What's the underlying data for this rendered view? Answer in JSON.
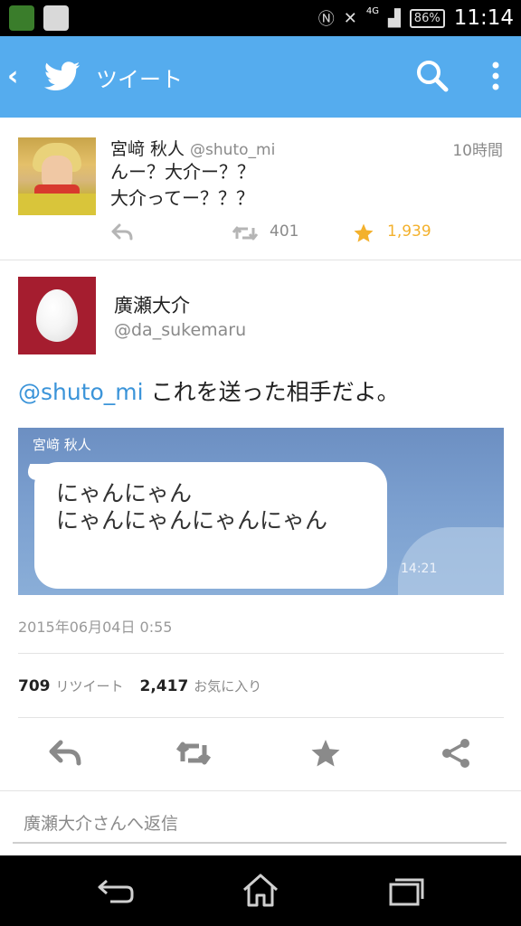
{
  "status_bar": {
    "network": "4G",
    "battery": "86%",
    "time": "11:14"
  },
  "app_bar": {
    "title": "ツイート"
  },
  "replied_tweet": {
    "name": "宮﨑 秋人",
    "handle": "@shuto_mi",
    "time": "10時間",
    "text": "んー？大介ー？？\n大介ってー？？？",
    "retweets": "401",
    "favorites": "1,939"
  },
  "main_tweet": {
    "name": "廣瀬大介",
    "handle": "@da_sukemaru",
    "mention": "@shuto_mi",
    "text": " これを送った相手だよ。",
    "image": {
      "sender": "宮﨑 秋人",
      "message": "にゃんにゃん\nにゃんにゃんにゃんにゃん",
      "time": "14:21"
    },
    "date": "2015年06月04日 0:55",
    "retweet_count": "709",
    "retweet_label": "リツイート",
    "favorite_count": "2,417",
    "favorite_label": "お気に入り"
  },
  "reply_box": {
    "placeholder": "廣瀬大介さんへ返信"
  },
  "colors": {
    "twitter_blue": "#55acee",
    "star_gold": "#f3b12d",
    "mention_blue": "#3b94d9",
    "avatar_red": "#a51d2f"
  },
  "icons": [
    "back-icon",
    "twitter-bird-icon",
    "search-icon",
    "more-icon",
    "reply-icon",
    "retweet-icon",
    "star-icon",
    "share-icon",
    "nav-back-icon",
    "nav-home-icon",
    "nav-recent-icon"
  ]
}
